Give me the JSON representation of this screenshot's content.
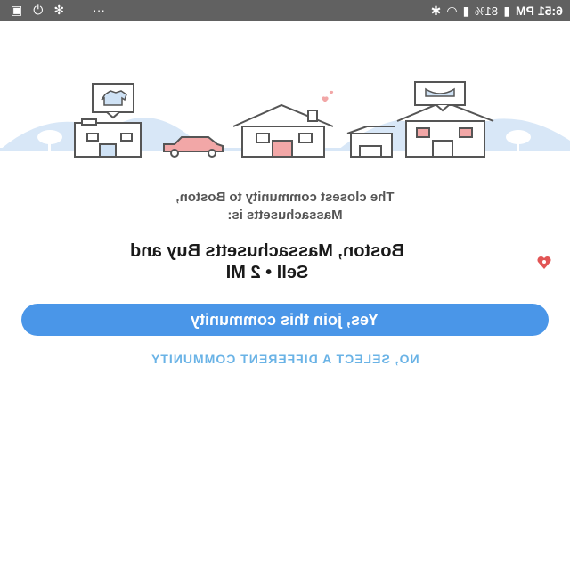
{
  "status_bar": {
    "time": "6:51 PM",
    "battery_percent": "81%",
    "glyph_wifi": "wifi-icon",
    "glyph_signal": "signal-icon",
    "glyph_bluetooth": "bluetooth-icon",
    "glyph_battery": "battery-icon",
    "glyph_more": "more-dots-icon",
    "glyph_fan": "fan-icon",
    "glyph_power": "power-icon",
    "glyph_photo": "photo-icon"
  },
  "intro": {
    "line1": "The closest community to Boston,",
    "line2": "Massachusetts is:"
  },
  "community": {
    "name_line1": "Boston, Massachusetts Buy and",
    "name_line2": "Sell • 2 MI"
  },
  "actions": {
    "join_label": "Yes, join this community",
    "different_label": "NO, SELECT A DIFFERENT COMMUNITY"
  },
  "colors": {
    "primary": "#4a96e8",
    "link": "#6ab3e6",
    "hill": "#d8e7f7",
    "accent_pink": "#f2a7a7",
    "heart": "#e25555"
  }
}
